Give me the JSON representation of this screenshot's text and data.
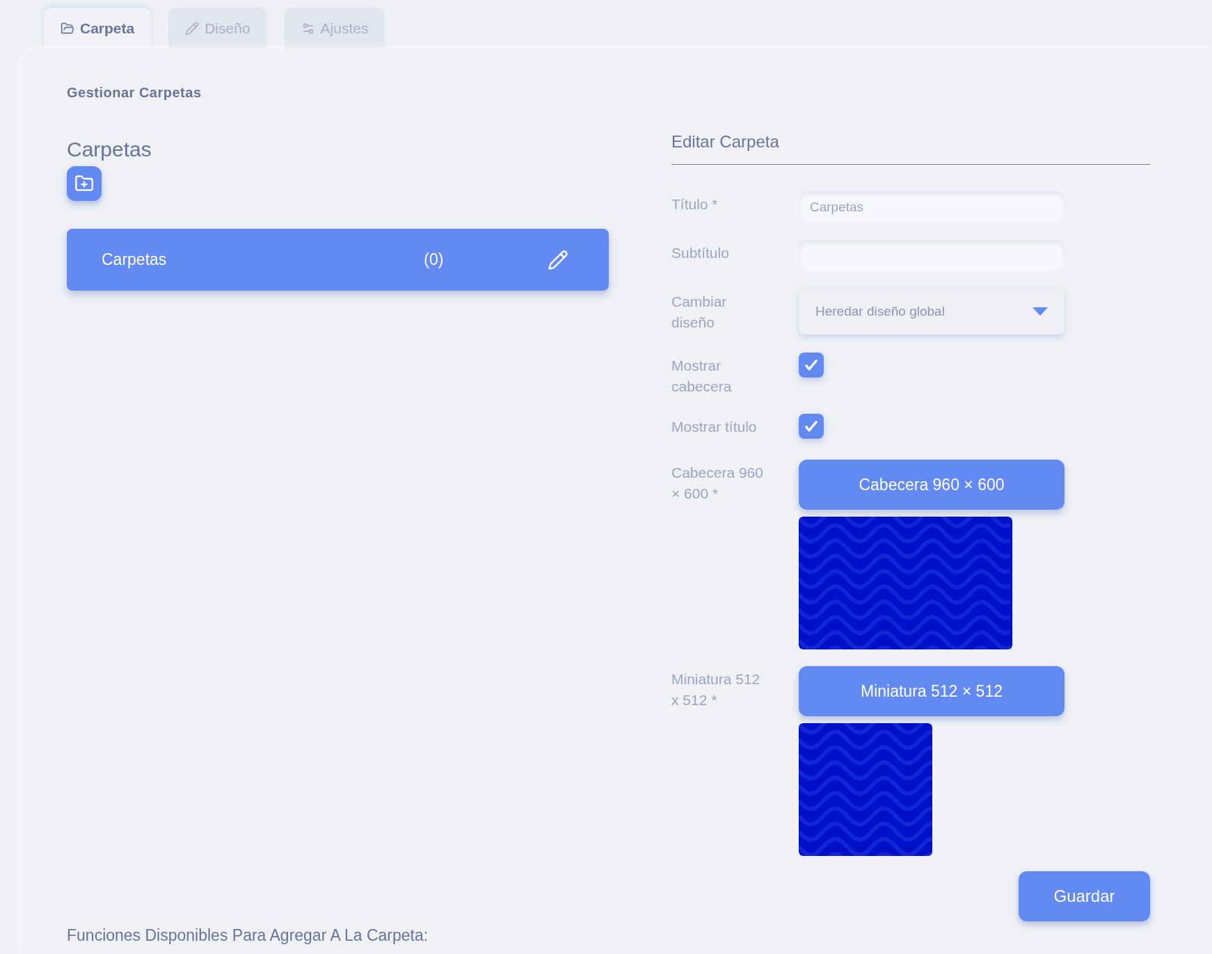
{
  "tabs": [
    {
      "label": "Carpeta",
      "selected": true
    },
    {
      "label": "Diseño",
      "selected": false
    },
    {
      "label": "Ajustes",
      "selected": false
    }
  ],
  "section_title": "Gestionar Carpetas",
  "folders": {
    "heading": "Carpetas",
    "items": [
      {
        "name": "Carpetas",
        "count": "(0)",
        "selected": true
      }
    ]
  },
  "edit": {
    "heading": "Editar Carpeta",
    "fields": [
      {
        "kind": "text",
        "label": "Título *",
        "value": "Carpetas"
      },
      {
        "kind": "text",
        "label": "Subtítulo"
      },
      {
        "kind": "select",
        "label": "Cambiar diseño",
        "value": "Heredar diseño global"
      },
      {
        "kind": "checkbox",
        "label": "Mostrar cabecera",
        "checked": true
      },
      {
        "kind": "checkbox",
        "label": "Mostrar título",
        "checked": true
      },
      {
        "kind": "upload",
        "label": "Cabecera 960 × 600 *",
        "button": "Cabecera 960 × 600"
      },
      {
        "kind": "upload",
        "label": "Miniatura 512 x 512 *",
        "button": "Miniatura 512 × 512"
      }
    ],
    "save": "Guardar"
  },
  "footer": "Funciones Disponibles Para Agregar A La Carpeta:"
}
